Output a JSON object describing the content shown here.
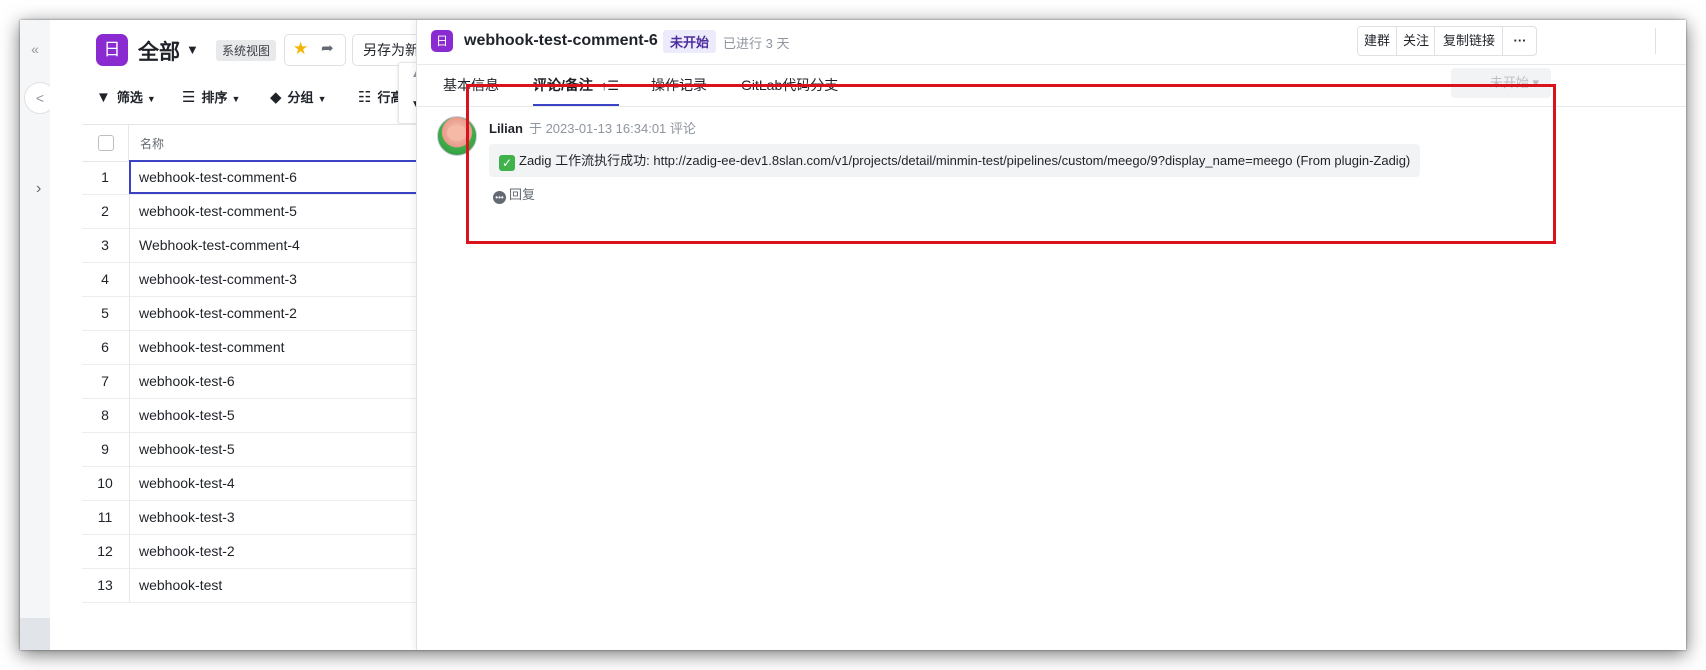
{
  "left_rail": {
    "collapse_icon": "«",
    "circle_icon": "<",
    "chevron_icon": "›"
  },
  "view": {
    "app_icon_glyph": "日",
    "title": "全部",
    "caret": "▼",
    "system_tag": "系统视图",
    "save_as": "另存为新视图"
  },
  "toolbar": {
    "filter": "筛选",
    "sort": "排序",
    "group": "分组",
    "row_height": "行高"
  },
  "table": {
    "header_name": "名称",
    "rows": [
      {
        "num": "1",
        "name": "webhook-test-comment-6"
      },
      {
        "num": "2",
        "name": "webhook-test-comment-5"
      },
      {
        "num": "3",
        "name": "Webhook-test-comment-4"
      },
      {
        "num": "4",
        "name": "webhook-test-comment-3"
      },
      {
        "num": "5",
        "name": "webhook-test-comment-2"
      },
      {
        "num": "6",
        "name": "webhook-test-comment"
      },
      {
        "num": "7",
        "name": "webhook-test-6"
      },
      {
        "num": "8",
        "name": "webhook-test-5"
      },
      {
        "num": "9",
        "name": "webhook-test-5"
      },
      {
        "num": "10",
        "name": "webhook-test-4"
      },
      {
        "num": "11",
        "name": "webhook-test-3"
      },
      {
        "num": "12",
        "name": "webhook-test-2"
      },
      {
        "num": "13",
        "name": "webhook-test"
      }
    ]
  },
  "detail": {
    "icon_glyph": "日",
    "title": "webhook-test-comment-6",
    "status": "未开始",
    "elapsed": "已进行 3 天",
    "actions": [
      "建群",
      "关注",
      "复制链接",
      "···"
    ],
    "tabs": [
      "基本信息",
      "评论/备注",
      "操作记录",
      "GitLab代码分支"
    ],
    "active_tab": "评论/备注",
    "status_select": "未开始 ▾",
    "comment": {
      "user": "Lilian",
      "meta": "于 2023-01-13 16:34:01 评论",
      "body": "Zadig 工作流执行成功: http://zadig-ee-dev1.8slan.com/v1/projects/detail/minmin-test/pipelines/custom/meego/9?display_name=meego (From plugin-Zadig)",
      "reply": "回复"
    }
  },
  "colors": {
    "accent": "#3b43c4",
    "app_icon": "#8a2bd1",
    "highlight": "#d9121b",
    "star": "#f5b400",
    "check": "#3fb24b"
  }
}
